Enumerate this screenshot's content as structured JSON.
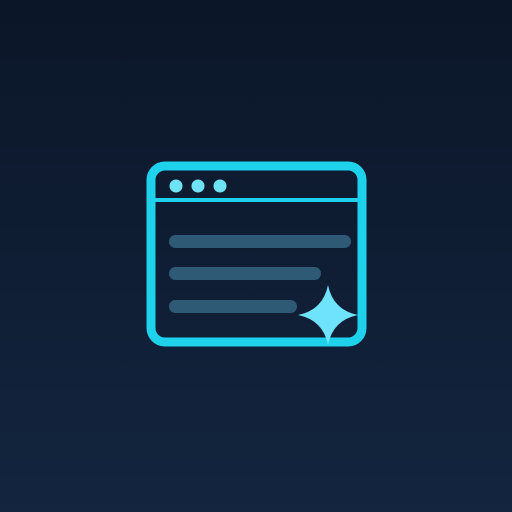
{
  "icon": {
    "name": "browser-window-sparkle-icon",
    "window_dots": 3,
    "content_lines": 3,
    "has_sparkle": true
  },
  "colors": {
    "background_top": "#0b1628",
    "background_bottom": "#13253f",
    "accent": "#1ed2ec",
    "dots": "#6fe3f5",
    "lines": "#2f5a76",
    "sparkle": "#6fe3fb"
  }
}
